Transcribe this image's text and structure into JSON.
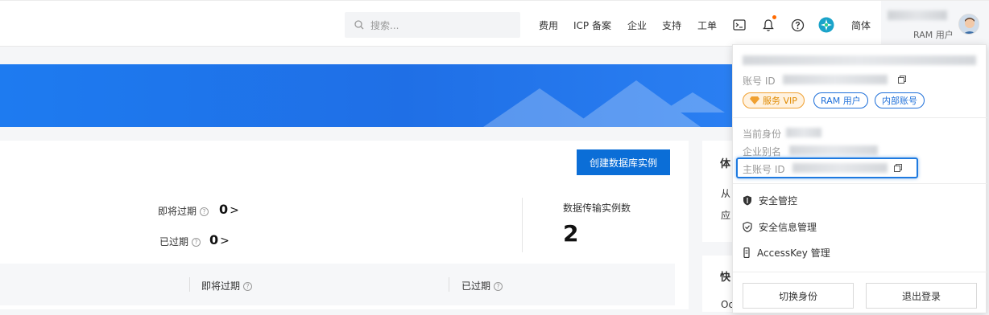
{
  "topbar": {
    "search_placeholder": "搜索...",
    "nav": [
      "费用",
      "ICP 备案",
      "企业",
      "支持",
      "工单"
    ],
    "lang": "简体",
    "ram_label": "RAM 用户"
  },
  "main": {
    "create_button": "创建数据库实例",
    "expiring_label": "即将过期",
    "expiring_count": "0",
    "expired_label": "已过期",
    "expired_count": "0",
    "transfer_label": "数据传输实例数",
    "transfer_count": "2",
    "table_headers": [
      "即将过期",
      "已过期"
    ],
    "side_card_title": "体",
    "side_text_1": "从",
    "side_text_2": "应",
    "side_card2_title": "快",
    "side_text_3": "Oc"
  },
  "dropdown": {
    "account_id_label": "账号 ID",
    "tags": [
      "服务 VIP",
      "RAM 用户",
      "内部账号"
    ],
    "current_identity_label": "当前身份",
    "enterprise_alias_label": "企业别名",
    "main_account_id_label": "主账号 ID",
    "menu": [
      "安全管控",
      "安全信息管理",
      "AccessKey 管理"
    ],
    "switch_button": "切换身份",
    "logout_button": "退出登录"
  },
  "colors": {
    "accent": "#0b6ed7",
    "banner": "#1e7bf0",
    "vip": "#e08a00",
    "notification_dot": "#ff6a00"
  },
  "icons": [
    "search-icon",
    "terminal-icon",
    "bell-icon",
    "help-icon",
    "app-icon",
    "copy-icon",
    "shield-icon",
    "shield-check-icon",
    "key-icon",
    "question-icon",
    "chevron-right-icon",
    "diamond-icon"
  ]
}
